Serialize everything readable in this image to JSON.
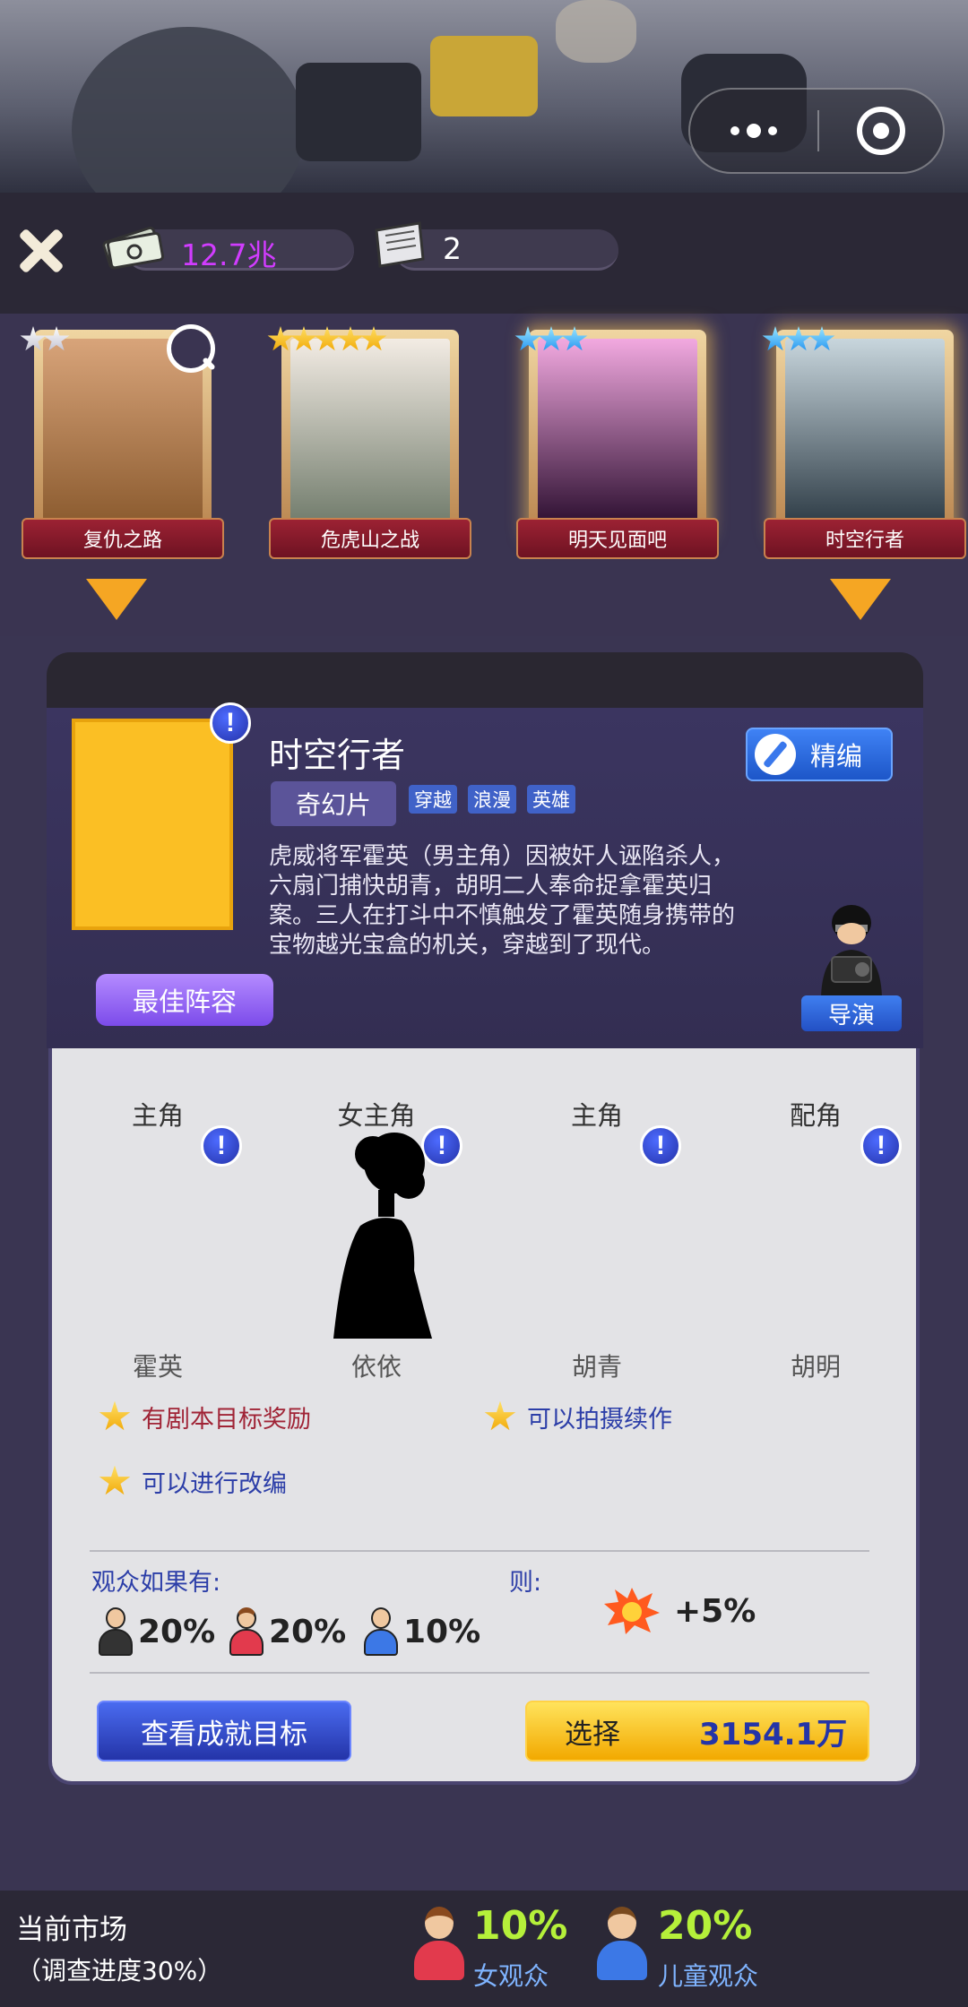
{
  "header": {
    "money": "12.7兆",
    "scripts": "2"
  },
  "movies": [
    {
      "title": "复仇之路",
      "stars": 2,
      "star_color": "white"
    },
    {
      "title": "危虎山之战",
      "stars": 5,
      "star_color": "gold"
    },
    {
      "title": "明天见面吧",
      "stars": 3,
      "star_color": "blue"
    },
    {
      "title": "时空行者",
      "stars": 3,
      "star_color": "blue",
      "selected": true
    }
  ],
  "detail": {
    "title": "时空行者",
    "genre": "奇幻片",
    "tags": [
      "穿越",
      "浪漫",
      "英雄"
    ],
    "edit_label": "精编",
    "synopsis": "虎威将军霍英（男主角）因被奸人诬陷杀人，六扇门捕快胡青，胡明二人奉命捉拿霍英归案。三人在打斗中不慎触发了霍英随身携带的宝物越光宝盒的机关，穿越到了现代。",
    "best_cast_label": "最佳阵容",
    "director_label": "导演",
    "warn_mark": "!"
  },
  "roles": [
    {
      "title": "主角",
      "name": "霍英"
    },
    {
      "title": "女主角",
      "name": "依依"
    },
    {
      "title": "主角",
      "name": "胡青"
    },
    {
      "title": "配角",
      "name": "胡明"
    }
  ],
  "perks": [
    "有剧本目标奖励",
    "可以拍摄续作",
    "可以进行改编"
  ],
  "audience": {
    "label": "观众如果有:",
    "then_label": "则:",
    "male": "20%",
    "female": "20%",
    "child": "10%",
    "bonus": "+5%"
  },
  "actions": {
    "achievements_label": "查看成就目标",
    "select_label": "选择",
    "select_price": "3154.1万"
  },
  "market": {
    "title": "当前市场",
    "subtitle": "（调查进度30%）",
    "female_value": "10%",
    "female_label": "女观众",
    "child_value": "20%",
    "child_label": "儿童观众"
  },
  "colors": {
    "accent_money": "#d13cff",
    "stat_green": "#b5f03a",
    "select_yellow": "#f2a900"
  }
}
